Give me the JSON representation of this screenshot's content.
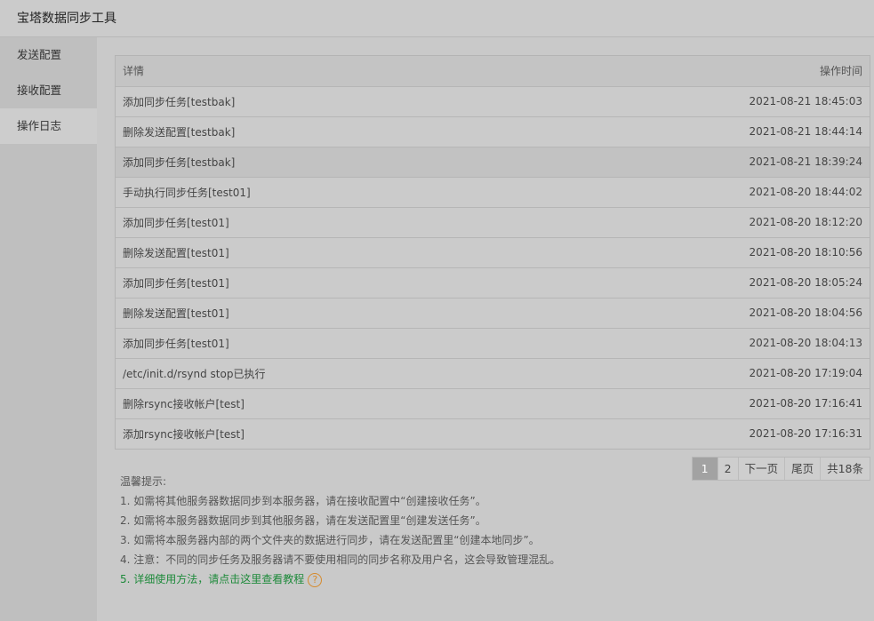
{
  "app": {
    "title": "宝塔数据同步工具"
  },
  "sidebar": {
    "items": [
      {
        "label": "发送配置",
        "active": false
      },
      {
        "label": "接收配置",
        "active": false
      },
      {
        "label": "操作日志",
        "active": true
      }
    ]
  },
  "log_table": {
    "columns": {
      "detail": "详情",
      "time": "操作时间"
    },
    "rows": [
      {
        "detail": "添加同步任务[testbak]",
        "time": "2021-08-21 18:45:03"
      },
      {
        "detail": "删除发送配置[testbak]",
        "time": "2021-08-21 18:44:14"
      },
      {
        "detail": "添加同步任务[testbak]",
        "time": "2021-08-21 18:39:24"
      },
      {
        "detail": "手动执行同步任务[test01]",
        "time": "2021-08-20 18:44:02"
      },
      {
        "detail": "添加同步任务[test01]",
        "time": "2021-08-20 18:12:20"
      },
      {
        "detail": "删除发送配置[test01]",
        "time": "2021-08-20 18:10:56"
      },
      {
        "detail": "添加同步任务[test01]",
        "time": "2021-08-20 18:05:24"
      },
      {
        "detail": "删除发送配置[test01]",
        "time": "2021-08-20 18:04:56"
      },
      {
        "detail": "添加同步任务[test01]",
        "time": "2021-08-20 18:04:13"
      },
      {
        "detail": "/etc/init.d/rsynd stop已执行",
        "time": "2021-08-20 17:19:04"
      },
      {
        "detail": "删除rsync接收帐户[test]",
        "time": "2021-08-20 17:16:41"
      },
      {
        "detail": "添加rsync接收帐户[test]",
        "time": "2021-08-20 17:16:31"
      }
    ]
  },
  "pager": {
    "current": "1",
    "page2": "2",
    "next": "下一页",
    "last": "尾页",
    "total": "共18条"
  },
  "tips": {
    "heading": "温馨提示:",
    "items": [
      "1. 如需将其他服务器数据同步到本服务器，请在接收配置中“创建接收任务”。",
      "2. 如需将本服务器数据同步到其他服务器，请在发送配置里“创建发送任务”。",
      "3. 如需将本服务器内部的两个文件夹的数据进行同步，请在发送配置里“创建本地同步”。",
      "4. 注意：不同的同步任务及服务器请不要使用相同的同步名称及用户名，这会导致管理混乱。"
    ],
    "link": "5. 详细使用方法，请点击这里查看教程",
    "help_glyph": "?"
  },
  "colors": {
    "link": "#1e8a3b",
    "help_icon": "#d68a2c",
    "active_page": "#a2a2a2"
  }
}
